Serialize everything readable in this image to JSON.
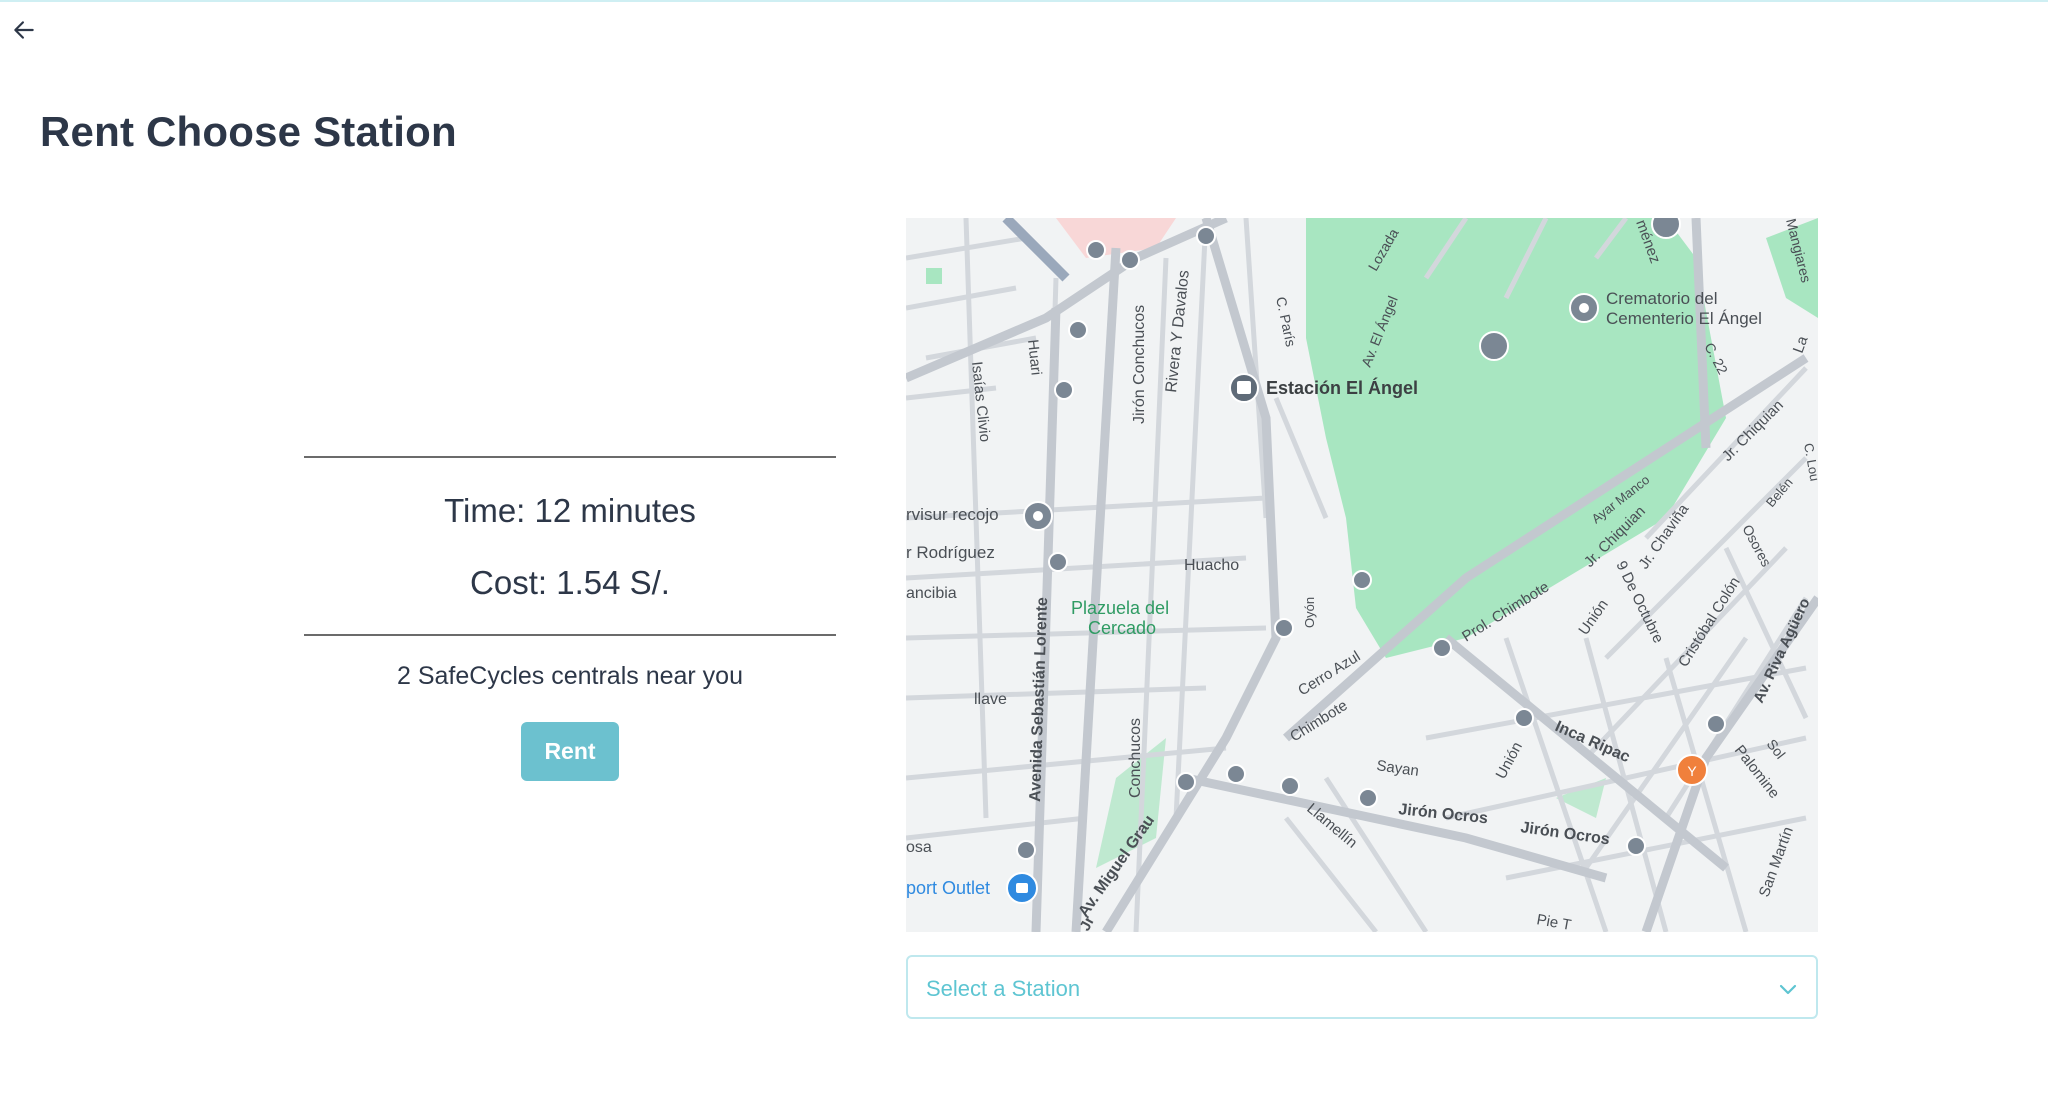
{
  "page": {
    "title": "Rent Choose Station",
    "back_icon": "arrow-left-icon"
  },
  "trip": {
    "time_text": "Time: 12 minutes",
    "cost_text": "Cost: 1.54 S/.",
    "nearby_text": "2 SafeCycles centrals near you"
  },
  "actions": {
    "rent_label": "Rent"
  },
  "station_select": {
    "placeholder": "Select a Station",
    "icon": "chevron-down-icon"
  },
  "map": {
    "labels": {
      "estacion": "Estación El Ángel",
      "crematorio_1": "Crematorio del",
      "crematorio_2": "Cementerio El Ángel",
      "plazuela_1": "Plazuela del",
      "plazuela_2": "Cercado",
      "huacho": "Huacho",
      "jiron_conchucos": "Jirón Conchucos",
      "conchucos": "Conchucos",
      "rivera": "Rivera Y Davalos",
      "huari": "Huari",
      "isaias": "Isaías Clivio",
      "avenida_lorente": "Avenida Sebastián Lorente",
      "av_miguel_grau": "Av. Miguel Grau",
      "jiron_ocros_1": "Jirón Ocros",
      "jiron_ocros_2": "Jirón Ocros",
      "inca_ripac": "Inca Ripac",
      "prol_chimbote": "Prol. Chimbote",
      "chimbote": "Chimbote",
      "cerro_azul": "Cerro Azul",
      "sayan": "Sayan",
      "union_1": "Unión",
      "union_2": "Unión",
      "jr_chiquian_1": "Jr. Chiquian",
      "jr_chiquian_2": "Jr. Chiquian",
      "jr_chavina": "Jr. Chaviña",
      "nueve_octubre": "9 De Octubre",
      "cristobal_colon": "Cristóbal Colón",
      "osores": "Osores",
      "av_riva_aguero": "Av. Riva Agüero",
      "palomine": "Palomine",
      "sol": "Sol",
      "san_martin": "San Martín",
      "llamellin": "Llamellín",
      "av_el_angel": "Av. El Ángel",
      "lozada": "Lozada",
      "c_paris": "C. París",
      "c22": "C. 22",
      "mangiares": "Mangiares",
      "ayar_manco": "Ayar Manco",
      "belen": "Belén",
      "oyon": "Oyón",
      "rvisur": "rvisur recojo",
      "rodriguez": "r Rodríguez",
      "ancibia": "ancibia",
      "llave": "llave",
      "osa": "osa",
      "port_outlet": "port Outlet",
      "menez": "ménez",
      "c_lou": "C. Lou",
      "la": "La",
      "pie": "Pie T",
      "jr": "Jr"
    }
  },
  "colors": {
    "accent": "#6cc1cf",
    "title": "#2d3748",
    "select_border": "#bfe8ee",
    "select_text": "#5ec5d2",
    "park": "#a8e6c1"
  }
}
